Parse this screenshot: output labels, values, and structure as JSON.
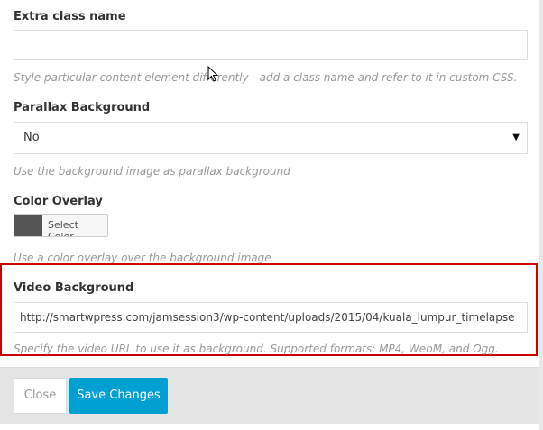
{
  "extra_class": {
    "label": "Extra class name",
    "value": "",
    "description": "Style particular content element differently - add a class name and refer to it in custom CSS."
  },
  "parallax": {
    "label": "Parallax Background",
    "selected": "No",
    "description": "Use the background image as parallax background"
  },
  "color_overlay": {
    "label": "Color Overlay",
    "button_label": "Select Color",
    "swatch_color": "#555555",
    "description": "Use a color overlay over the background image"
  },
  "video_bg": {
    "label": "Video Background",
    "value": "http://smartwpress.com/jamsession3/wp-content/uploads/2015/04/kuala_lumpur_timelapse",
    "description": "Specify the video URL to use it as background. Supported formats: MP4, WebM, and Ogg."
  },
  "footer": {
    "close_label": "Close",
    "save_label": "Save Changes"
  },
  "colors": {
    "highlight": "#cc0000",
    "primary": "#00a0d2"
  }
}
